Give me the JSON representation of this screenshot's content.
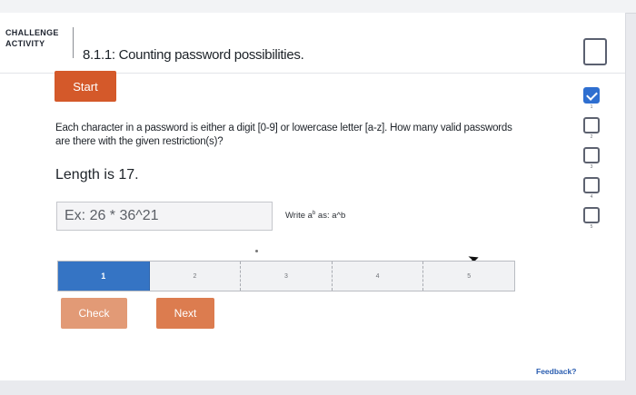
{
  "header": {
    "challenge_label_line1": "CHALLENGE",
    "challenge_label_line2": "ACTIVITY",
    "title": "8.1.1: Counting password possibilities."
  },
  "activity": {
    "start_label": "Start",
    "question": "Each character in a password is either a digit [0-9] or lowercase letter [a-z]. How many valid passwords are there with the given restriction(s)?",
    "restriction": "Length is 17.",
    "answer_placeholder": "Ex: 26 * 36^21",
    "hint_prefix": "Write a",
    "hint_sup": "b",
    "hint_suffix": " as: a^b",
    "check_label": "Check",
    "next_label": "Next",
    "progress_steps": [
      "1",
      "2",
      "3",
      "4",
      "5"
    ],
    "current_step": 1
  },
  "levels": {
    "items": [
      {
        "num": "1",
        "done": true
      },
      {
        "num": "2",
        "done": false
      },
      {
        "num": "3",
        "done": false
      },
      {
        "num": "4",
        "done": false
      },
      {
        "num": "5",
        "done": false
      }
    ]
  },
  "footer": {
    "feedback_label": "Feedback?"
  },
  "colors": {
    "accent": "#d4592a",
    "progress_active": "#3574c4",
    "level_done": "#2f6fd0"
  }
}
